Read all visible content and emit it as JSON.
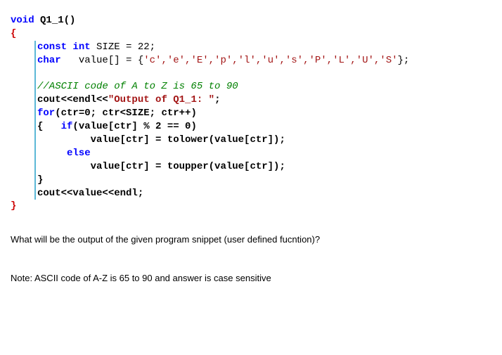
{
  "code": {
    "l1_kw1": "void",
    "l1_fn": " Q1_1()",
    "l2_brace": "{",
    "l3_kw1": "const",
    "l3_kw2": " int",
    "l3_rest": " SIZE = 22;",
    "l4_kw1": "char",
    "l4_var": "   value[] = ",
    "l4_open": "{",
    "l4_chars": "'c','e','E','p','l','u','s','P','L','U','S'",
    "l4_close": "};",
    "l6_comment": "//ASCII code of A to Z is 65 to 90",
    "l7_a": "cout<<endl<<",
    "l7_str": "\"Output of Q1_1: \"",
    "l7_c": ";",
    "l8_kw": "for",
    "l8_rest": "(ctr=0; ctr<SIZE; ctr++)",
    "l9_brace": "{   ",
    "l9_kw": "if",
    "l9_cond": "(value[ctr] % 2 == 0)",
    "l10": "         value[ctr] = tolower(value[ctr]);",
    "l11_kw": "     else",
    "l12": "         value[ctr] = toupper(value[ctr]);",
    "l13_brace": "}",
    "l14": "cout<<value<<endl;",
    "l15_brace": "}"
  },
  "question": "What will be the output of the given program snippet (user defined fucntion)?",
  "note": "Note:  ASCII code of A-Z is 65 to 90 and answer is case sensitive"
}
